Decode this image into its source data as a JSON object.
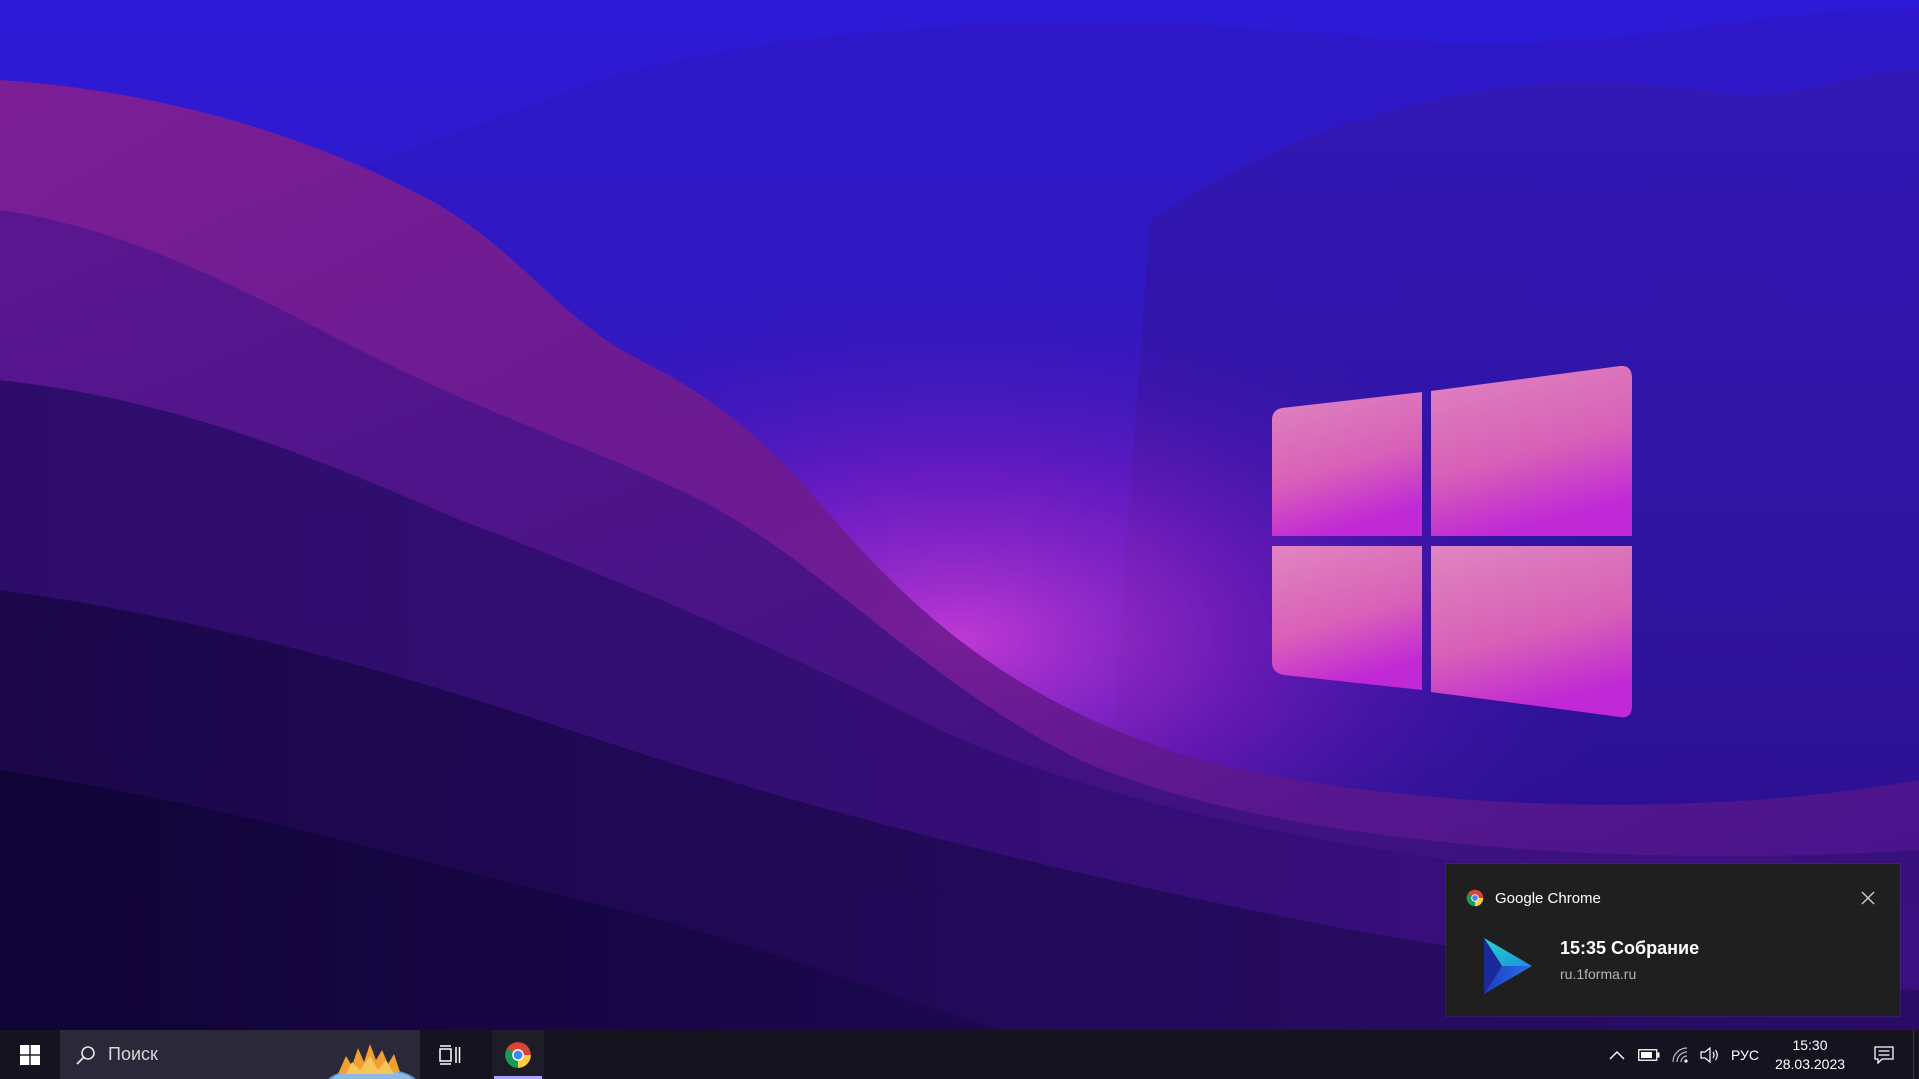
{
  "desktop": {
    "wallpaper": "purple-mountain-wallpaper",
    "logo": "windows-logo"
  },
  "toast": {
    "app_name": "Google Chrome",
    "title": "15:35 Собрание",
    "source": "ru.1forma.ru",
    "app_icon": "chrome-icon",
    "body_icon": "1forma-play-logo-icon",
    "close_icon": "close-icon"
  },
  "taskbar": {
    "start_icon": "windows-start-icon",
    "search": {
      "placeholder": "Поиск",
      "icon": "search-icon"
    },
    "task_view_icon": "task-view-icon",
    "pinned_apps": [
      {
        "name": "Google Chrome",
        "icon": "chrome-icon",
        "active": true
      }
    ],
    "tray": {
      "chevron_icon": "chevron-up-icon",
      "battery_icon": "battery-icon",
      "network_icon": "wifi-icon",
      "volume_icon": "volume-icon",
      "language": "РУС"
    },
    "clock": {
      "time": "15:30",
      "date": "28.03.2023"
    },
    "notifications_icon": "action-center-icon"
  },
  "colors": {
    "taskbar_bg": "#15131f",
    "search_bg": "#2b2839",
    "toast_bg": "#1f1f1f",
    "accent": "#a9a3ff"
  }
}
